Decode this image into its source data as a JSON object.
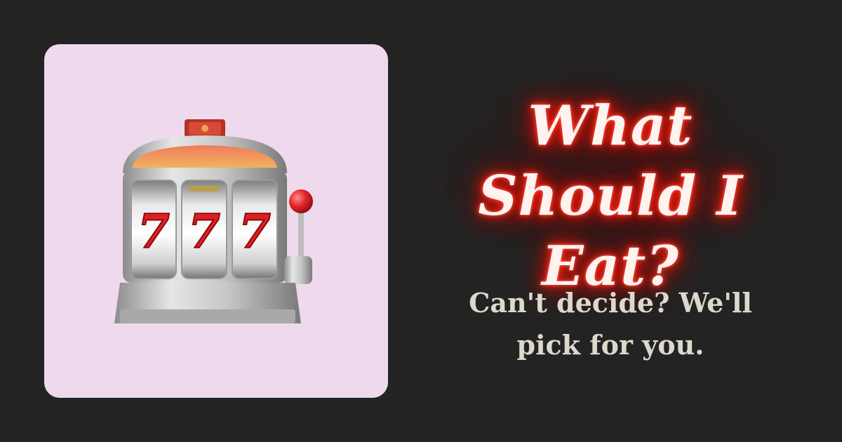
{
  "hero": {
    "illustration_icon": "slot-machine-777-icon",
    "card_color": "#eedaec",
    "title": "What Should I Eat?",
    "subtitle": "Can't decide? We'll pick for you."
  },
  "colors": {
    "background": "#232323",
    "neon_glow": "#e8150a",
    "title_text": "#fff3f0",
    "subtitle_text": "#dcd8cc"
  }
}
